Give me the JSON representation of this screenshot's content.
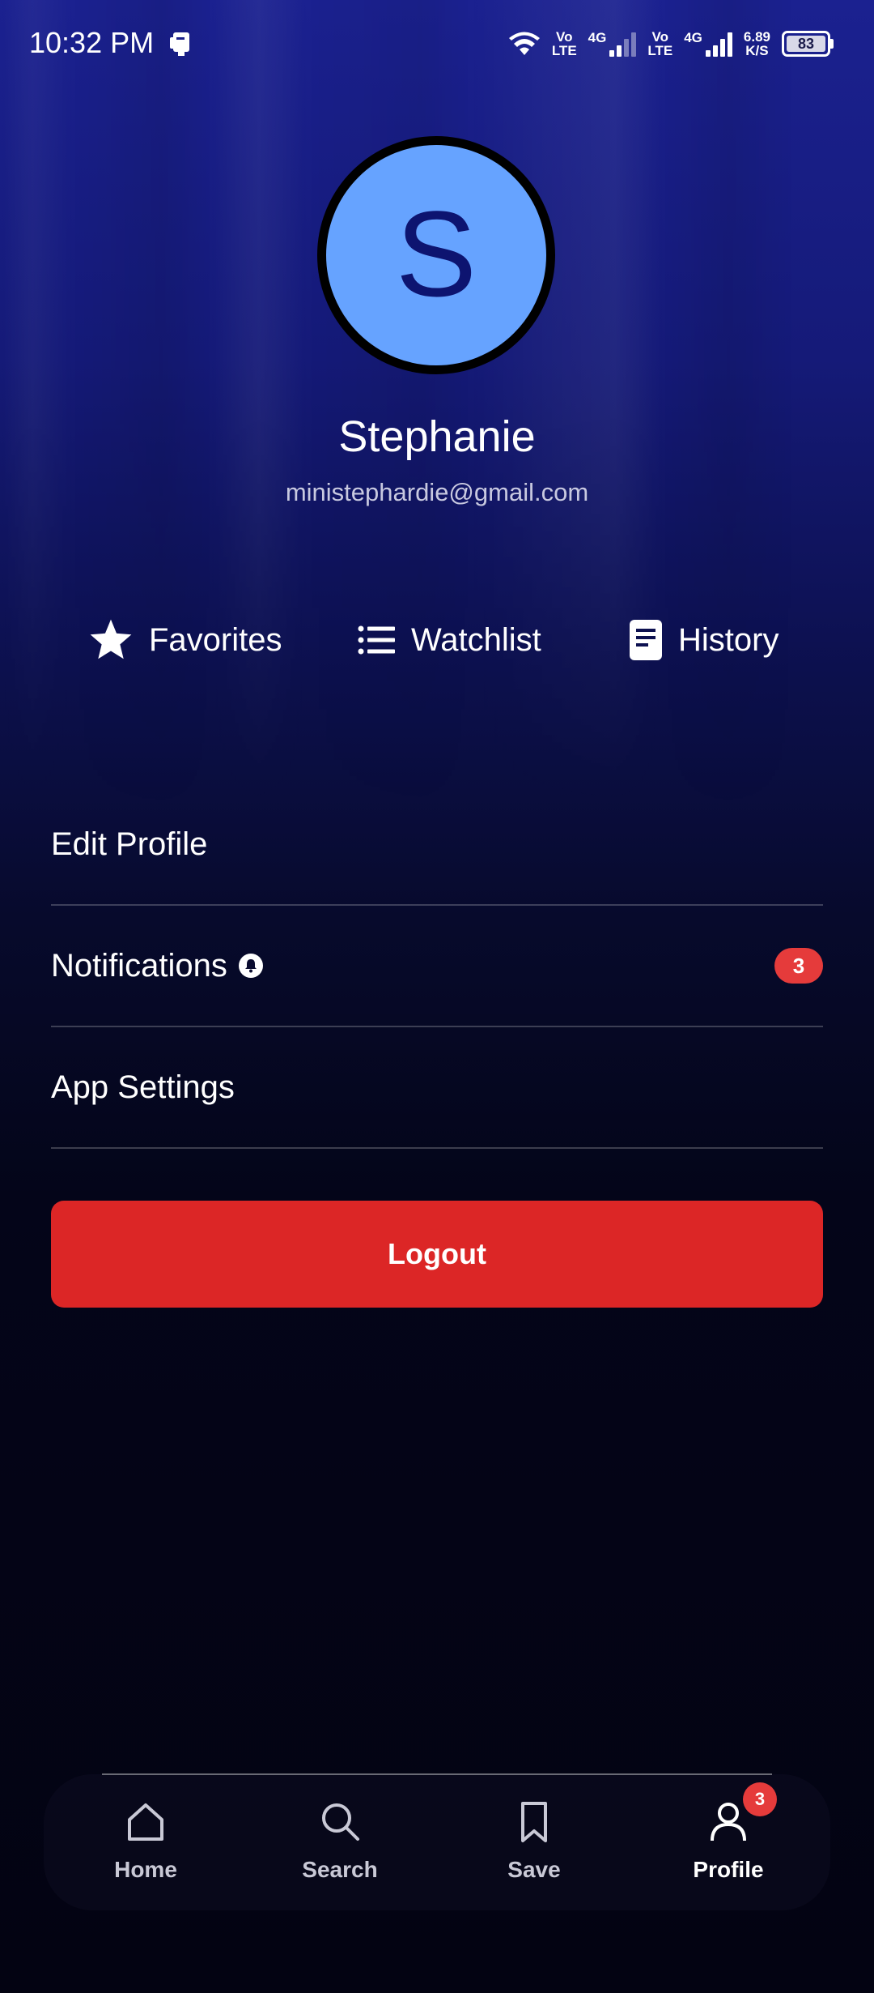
{
  "status_bar": {
    "time": "10:32 PM",
    "sim1_label_top": "Vo",
    "sim1_label_bottom": "LTE",
    "sim1_network": "4G",
    "sim2_label_top": "Vo",
    "sim2_label_bottom": "LTE",
    "sim2_network": "4G",
    "speed_value": "6.89",
    "speed_unit": "K/S",
    "battery": "83"
  },
  "profile": {
    "initial": "S",
    "name": "Stephanie",
    "email": "ministephardie@gmail.com",
    "avatar_color": "#66a3ff"
  },
  "quick_links": {
    "favorites": "Favorites",
    "watchlist": "Watchlist",
    "history": "History"
  },
  "menu": {
    "edit_profile": "Edit Profile",
    "notifications": "Notifications",
    "notifications_count": "3",
    "app_settings": "App Settings"
  },
  "logout": {
    "label": "Logout",
    "color": "#dc2626"
  },
  "bottom_nav": {
    "home": "Home",
    "search": "Search",
    "save": "Save",
    "profile": "Profile",
    "profile_badge": "3",
    "active": "Profile"
  }
}
